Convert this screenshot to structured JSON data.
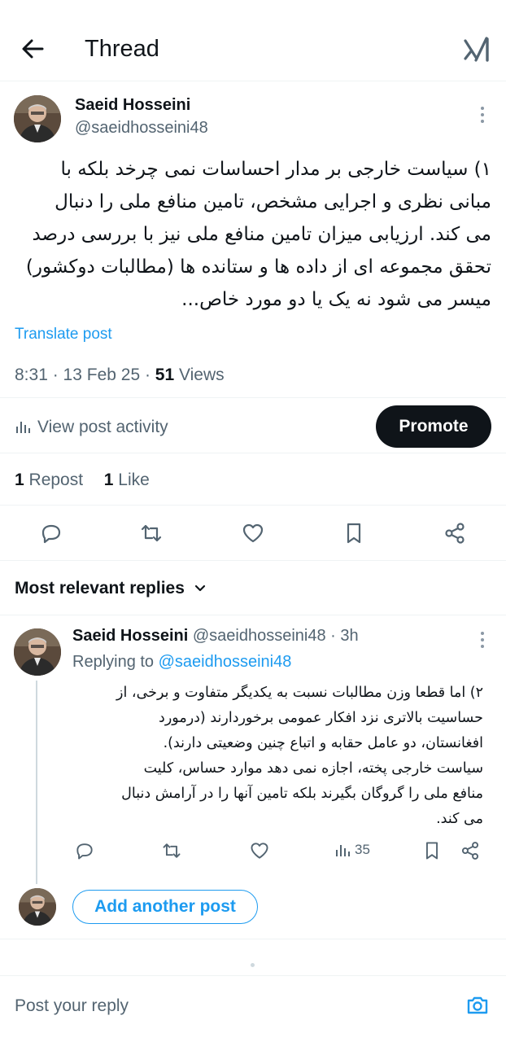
{
  "header": {
    "title": "Thread",
    "back_icon": "arrow-left-icon",
    "logo_icon": "grok-logo-icon"
  },
  "post": {
    "author_name": "Saeid Hosseini",
    "author_handle": "@saeidhosseini48",
    "text_lines": [
      "۱) سیاست خارجی بر مدار احساسات نمی چرخد بلکه با",
      "مبانی نظری و اجرایی مشخص، تامین منافع ملی را دنبال",
      "می کند. ارزیابی میزان تامین منافع ملی نیز با بررسی درصد",
      "تحقق مجموعه ای از داده ها و ستانده ها (مطالبات دوکشور)",
      "میسر می شود نه یک یا دو مورد خاص..."
    ],
    "translate_label": "Translate post",
    "time": "8:31",
    "date": "13 Feb 25",
    "views_count": "51",
    "views_label": "Views",
    "activity_label": "View post activity",
    "promote_label": "Promote",
    "reposts_count": "1",
    "reposts_label": "Repost",
    "likes_count": "1",
    "likes_label": "Like"
  },
  "replies_section": {
    "sort_label": "Most relevant replies"
  },
  "reply": {
    "author_name": "Saeid Hosseini",
    "author_handle": "@saeidhosseini48",
    "age": "3h",
    "replying_prefix": "Replying to",
    "replying_handle": "@saeidhosseini48",
    "text_lines": [
      "۲) اما قطعا وزن مطالبات نسبت به یکدیگر متفاوت و برخی، از",
      "حساسیت بالاتری نزد افکار عمومی برخوردارند (درمورد",
      "افغانستان، دو عامل حقابه و اتباع چنین وضعیتی دارند).",
      "سیاست خارجی پخته، اجازه نمی دهد موارد حساس، کلیت",
      "منافع ملی را گروگان بگیرند بلکه تامین آنها را در آرامش دنبال",
      "می کند."
    ],
    "views_count": "35"
  },
  "add_post_label": "Add another post",
  "composer": {
    "placeholder": "Post your reply",
    "camera_icon": "camera-icon"
  },
  "colors": {
    "accent": "#1d9bf0",
    "text": "#0f1419",
    "muted": "#536471",
    "divider": "#eff3f4"
  }
}
